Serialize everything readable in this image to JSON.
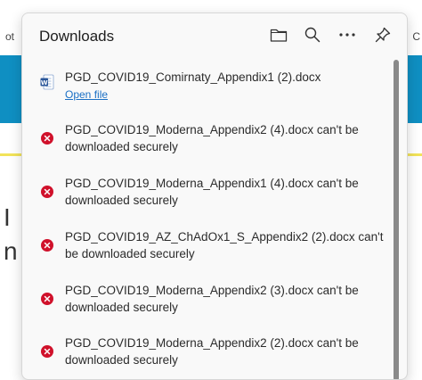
{
  "background": {
    "left_text": "ot",
    "right_text": "C",
    "big_char_1": "I",
    "big_char_2": "n"
  },
  "panel": {
    "title": "Downloads",
    "icons": [
      "folder-icon",
      "search-icon",
      "more-icon",
      "pin-icon"
    ]
  },
  "downloads": [
    {
      "filename": "PGD_COVID19_Comirnaty_Appendix1 (2).docx",
      "action": "Open file",
      "status": "complete",
      "icon": "word-doc-icon"
    },
    {
      "filename": "PGD_COVID19_Moderna_Appendix2 (4).docx can't be downloaded securely",
      "status": "blocked",
      "icon": "error-icon"
    },
    {
      "filename": "PGD_COVID19_Moderna_Appendix1 (4).docx can't be downloaded securely",
      "status": "blocked",
      "icon": "error-icon"
    },
    {
      "filename": "PGD_COVID19_AZ_ChAdOx1_S_Appendix2 (2).docx can't be downloaded securely",
      "status": "blocked",
      "icon": "error-icon"
    },
    {
      "filename": "PGD_COVID19_Moderna_Appendix2 (3).docx can't be downloaded securely",
      "status": "blocked",
      "icon": "error-icon"
    },
    {
      "filename": "PGD_COVID19_Moderna_Appendix2 (2).docx can't be downloaded securely",
      "status": "blocked",
      "icon": "error-icon"
    }
  ],
  "colors": {
    "error": "#d0112b",
    "link": "#1a6fc4",
    "word": "#2b579a",
    "background_band": "#0f8fc2"
  }
}
